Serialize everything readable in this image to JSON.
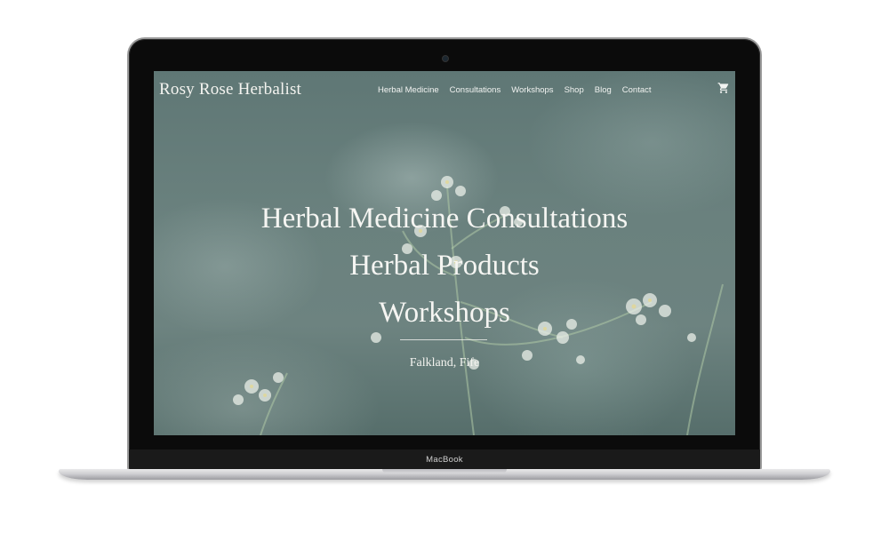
{
  "device": {
    "label": "MacBook"
  },
  "site": {
    "brand": "Rosy Rose Herbalist",
    "nav": [
      {
        "label": "Herbal Medicine"
      },
      {
        "label": "Consultations"
      },
      {
        "label": "Workshops"
      },
      {
        "label": "Shop"
      },
      {
        "label": "Blog"
      },
      {
        "label": "Contact"
      }
    ],
    "cart_icon": "shopping-cart-icon",
    "hero": {
      "lines": [
        "Herbal Medicine Consultations",
        "Herbal Products",
        "Workshops"
      ],
      "location": "Falkland, Fife"
    }
  },
  "colors": {
    "overlay": "#6a817e",
    "text": "#f5f5f2",
    "bezel": "#0b0b0b"
  }
}
